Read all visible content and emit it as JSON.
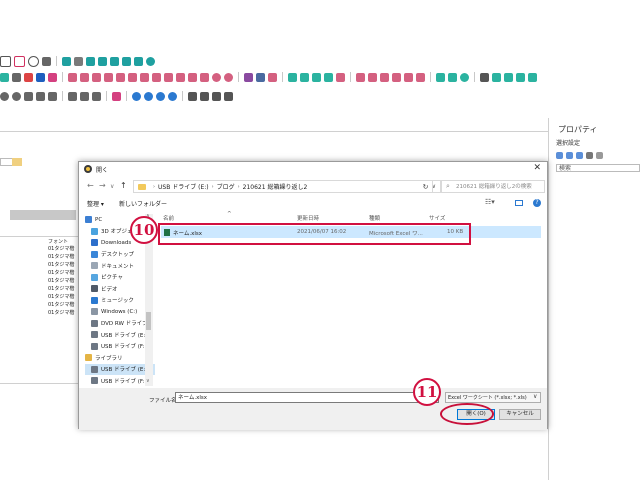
{
  "properties_panel": {
    "title": "プロパティ",
    "section": "選択設定",
    "search": "検索"
  },
  "background_list": {
    "header": "フォント",
    "rows": [
      "01タジマ楷",
      "01タジマ楷",
      "01タジマ楷",
      "01タジマ楷",
      "01タジマ楷",
      "01タジマ楷",
      "01タジマ楷",
      "01タジマ楷",
      "01タジマ楷"
    ]
  },
  "dialog": {
    "title": "開く",
    "breadcrumb": [
      "USB ドライブ (E:)",
      "ブログ",
      "210621 総箱繰り返し2"
    ],
    "search_placeholder": "210621 総箱繰り返し2の検索",
    "toolbar": {
      "organize": "整理 ▾",
      "new_folder": "新しいフォルダー"
    },
    "nav_items": [
      {
        "label": "PC",
        "icon": "pc-icon",
        "color": "#3c7fd3"
      },
      {
        "label": "3D オブジェクト",
        "icon": "cube-icon",
        "color": "#4aa3df"
      },
      {
        "label": "Downloads",
        "icon": "download-icon",
        "color": "#2d6fcb"
      },
      {
        "label": "デスクトップ",
        "icon": "desktop-icon",
        "color": "#3a86d8"
      },
      {
        "label": "ドキュメント",
        "icon": "document-icon",
        "color": "#9aa6b4"
      },
      {
        "label": "ピクチャ",
        "icon": "picture-icon",
        "color": "#56a6e0"
      },
      {
        "label": "ビデオ",
        "icon": "video-icon",
        "color": "#505a68"
      },
      {
        "label": "ミュージック",
        "icon": "music-icon",
        "color": "#2b79d0"
      },
      {
        "label": "Windows (C:)",
        "icon": "drive-icon",
        "color": "#8a96a4"
      },
      {
        "label": "DVD RW ドライブ",
        "icon": "dvd-icon",
        "color": "#6d7784"
      },
      {
        "label": "USB ドライブ (E:)",
        "icon": "usb-icon",
        "color": "#6d7784"
      },
      {
        "label": "USB ドライブ (F:)",
        "icon": "usb-icon",
        "color": "#6d7784"
      },
      {
        "label": "ライブラリ",
        "icon": "library-icon",
        "color": "#e4b445"
      },
      {
        "label": "USB ドライブ (E:)",
        "icon": "usb-icon",
        "color": "#6d7784"
      },
      {
        "label": "USB ドライブ (F:)",
        "icon": "usb-icon",
        "color": "#6d7784"
      }
    ],
    "selected_nav_index": 13,
    "columns": {
      "name": "名前",
      "date": "更新日時",
      "type": "種類",
      "size": "サイズ"
    },
    "file": {
      "name": "ネーム.xlsx",
      "date": "2021/06/07 16:02",
      "type": "Microsoft Excel ワ...",
      "size": "10 KB"
    },
    "file_name_label": "ファイル名(N):",
    "file_name_value": "ネーム.xlsx",
    "file_type": "Excel ワークシート (*.xlsx; *.xls)",
    "open_button": "開く(O)",
    "cancel_button": "キャンセル"
  },
  "annotations": {
    "step_file": "10",
    "step_open": "11",
    "accent": "#d11040"
  }
}
